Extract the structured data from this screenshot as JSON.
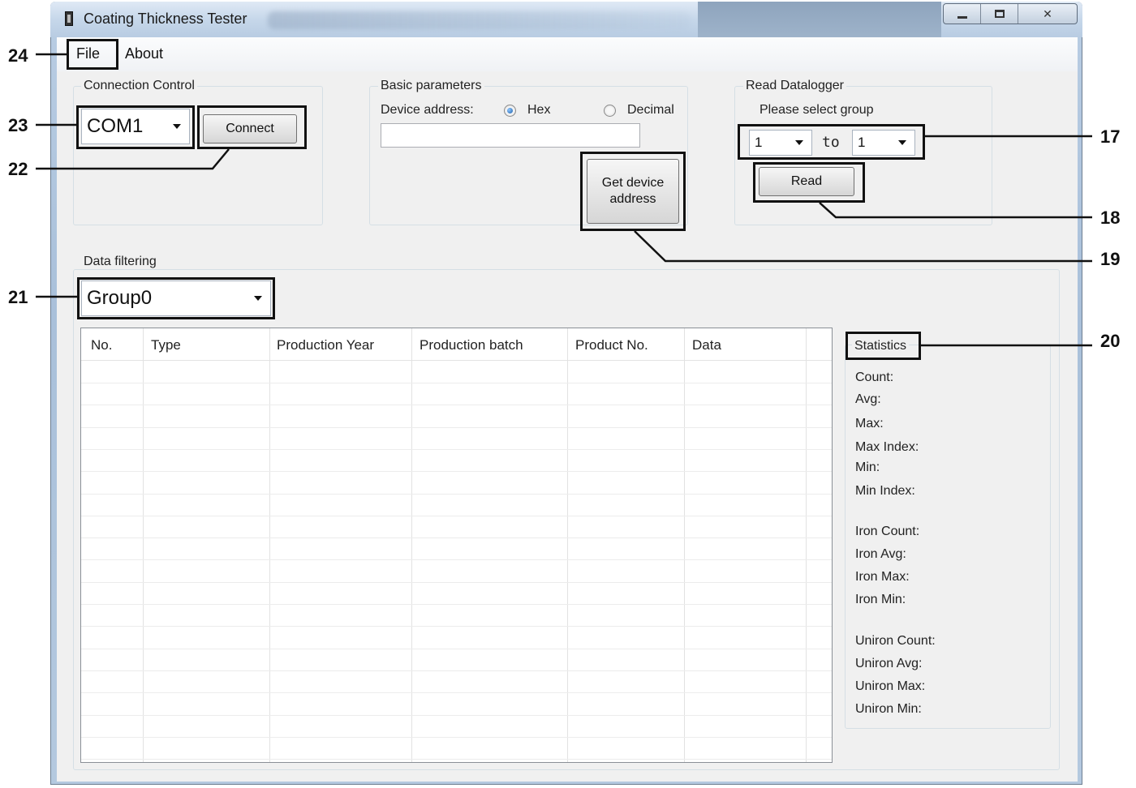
{
  "window": {
    "title": "Coating Thickness Tester",
    "controls": {
      "minimize": "minimize",
      "maximize": "maximize",
      "close": "✕"
    }
  },
  "menu": {
    "file": "File",
    "about": "About"
  },
  "connection_control": {
    "title": "Connection Control",
    "port_value": "COM1",
    "connect_label": "Connect"
  },
  "basic_parameters": {
    "title": "Basic parameters",
    "device_address_label": "Device address:",
    "hex_label": "Hex",
    "decimal_label": "Decimal",
    "hex_selected": true,
    "address_value": "",
    "get_address_label": "Get device address"
  },
  "read_datalogger": {
    "title": "Read Datalogger",
    "prompt": "Please select group",
    "from_value": "1",
    "to_label": "to",
    "to_value": "1",
    "read_label": "Read"
  },
  "data_filtering": {
    "title": "Data filtering",
    "group_value": "Group0"
  },
  "table": {
    "columns": [
      "No.",
      "Type",
      "Production Year",
      "Production batch",
      "Product No.",
      "Data"
    ],
    "rows": []
  },
  "statistics": {
    "title": "Statistics",
    "labels": [
      "Count:",
      "Avg:",
      "Max:",
      "Max Index:",
      "Min:",
      "Min Index:",
      "Iron Count:",
      "Iron Avg:",
      "Iron Max:",
      "Iron Min:",
      "Uniron Count:",
      "Uniron Avg:",
      "Uniron Max:",
      "Uniron Min:"
    ]
  },
  "callouts": {
    "c17": "17",
    "c18": "18",
    "c19": "19",
    "c20": "20",
    "c21": "21",
    "c22": "22",
    "c23": "23",
    "c24": "24"
  }
}
